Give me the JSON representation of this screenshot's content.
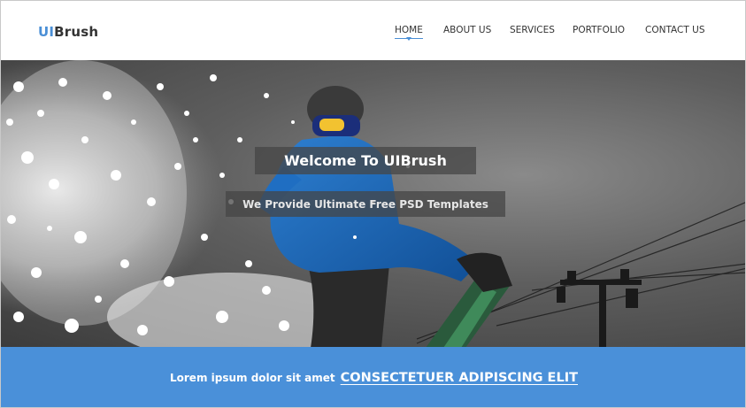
{
  "header": {
    "logo_accent": "UI",
    "logo_rest": "Brush",
    "accent_color": "#4a8fd6"
  },
  "nav": {
    "items": [
      {
        "label": "HOME",
        "active": true
      },
      {
        "label": "ABOUT US",
        "active": false
      },
      {
        "label": "SERVICES",
        "active": false
      },
      {
        "label": "PORTFOLIO",
        "active": false
      },
      {
        "label": "CONTACT US",
        "active": false
      }
    ]
  },
  "hero": {
    "title": "Welcome To UIBrush",
    "subtitle": "We Provide Ultimate Free PSD Templates",
    "image_subject": "snowboarder-photo"
  },
  "banner": {
    "text": "Lorem ipsum dolor sit amet",
    "link": "CONSECTETUER ADIPISCING ELIT",
    "background_color": "#4a90d9"
  }
}
